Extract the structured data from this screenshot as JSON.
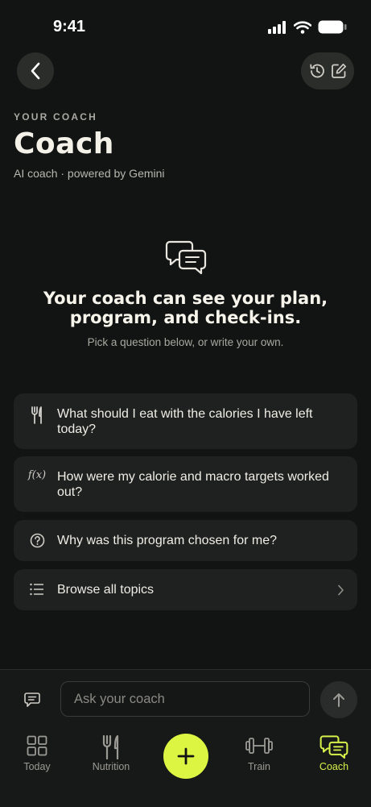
{
  "status_bar": {
    "time": "9:41"
  },
  "header": {
    "eyebrow": "YOUR COACH",
    "title": "Coach",
    "subtitle": "AI coach · powered by Gemini"
  },
  "hero": {
    "icon": "chat-bubbles-icon",
    "title": "Your coach can see your plan, program, and check-ins.",
    "subtitle": "Pick a question below, or write your own."
  },
  "suggestions": [
    {
      "icon": "fork-knife-icon",
      "text": "What should I eat with the calories I have left today?"
    },
    {
      "icon": "function-icon",
      "icon_text": "f(x)",
      "text": "How were my calorie and macro targets worked out?"
    },
    {
      "icon": "question-circle-icon",
      "text": "Why was this program chosen for me?"
    },
    {
      "icon": "list-icon",
      "text": "Browse all topics"
    }
  ],
  "composer": {
    "placeholder": "Ask your coach"
  },
  "tabs": [
    {
      "label": "Today",
      "icon": "grid-icon"
    },
    {
      "label": "Nutrition",
      "icon": "fork-knife-icon"
    },
    {
      "label": "Train",
      "icon": "dumbbell-icon"
    },
    {
      "label": "Coach",
      "icon": "chat-bubbles-icon",
      "active": true
    }
  ],
  "colors": {
    "accent": "#dcf542",
    "background": "#121413",
    "card": "#1f2120"
  }
}
